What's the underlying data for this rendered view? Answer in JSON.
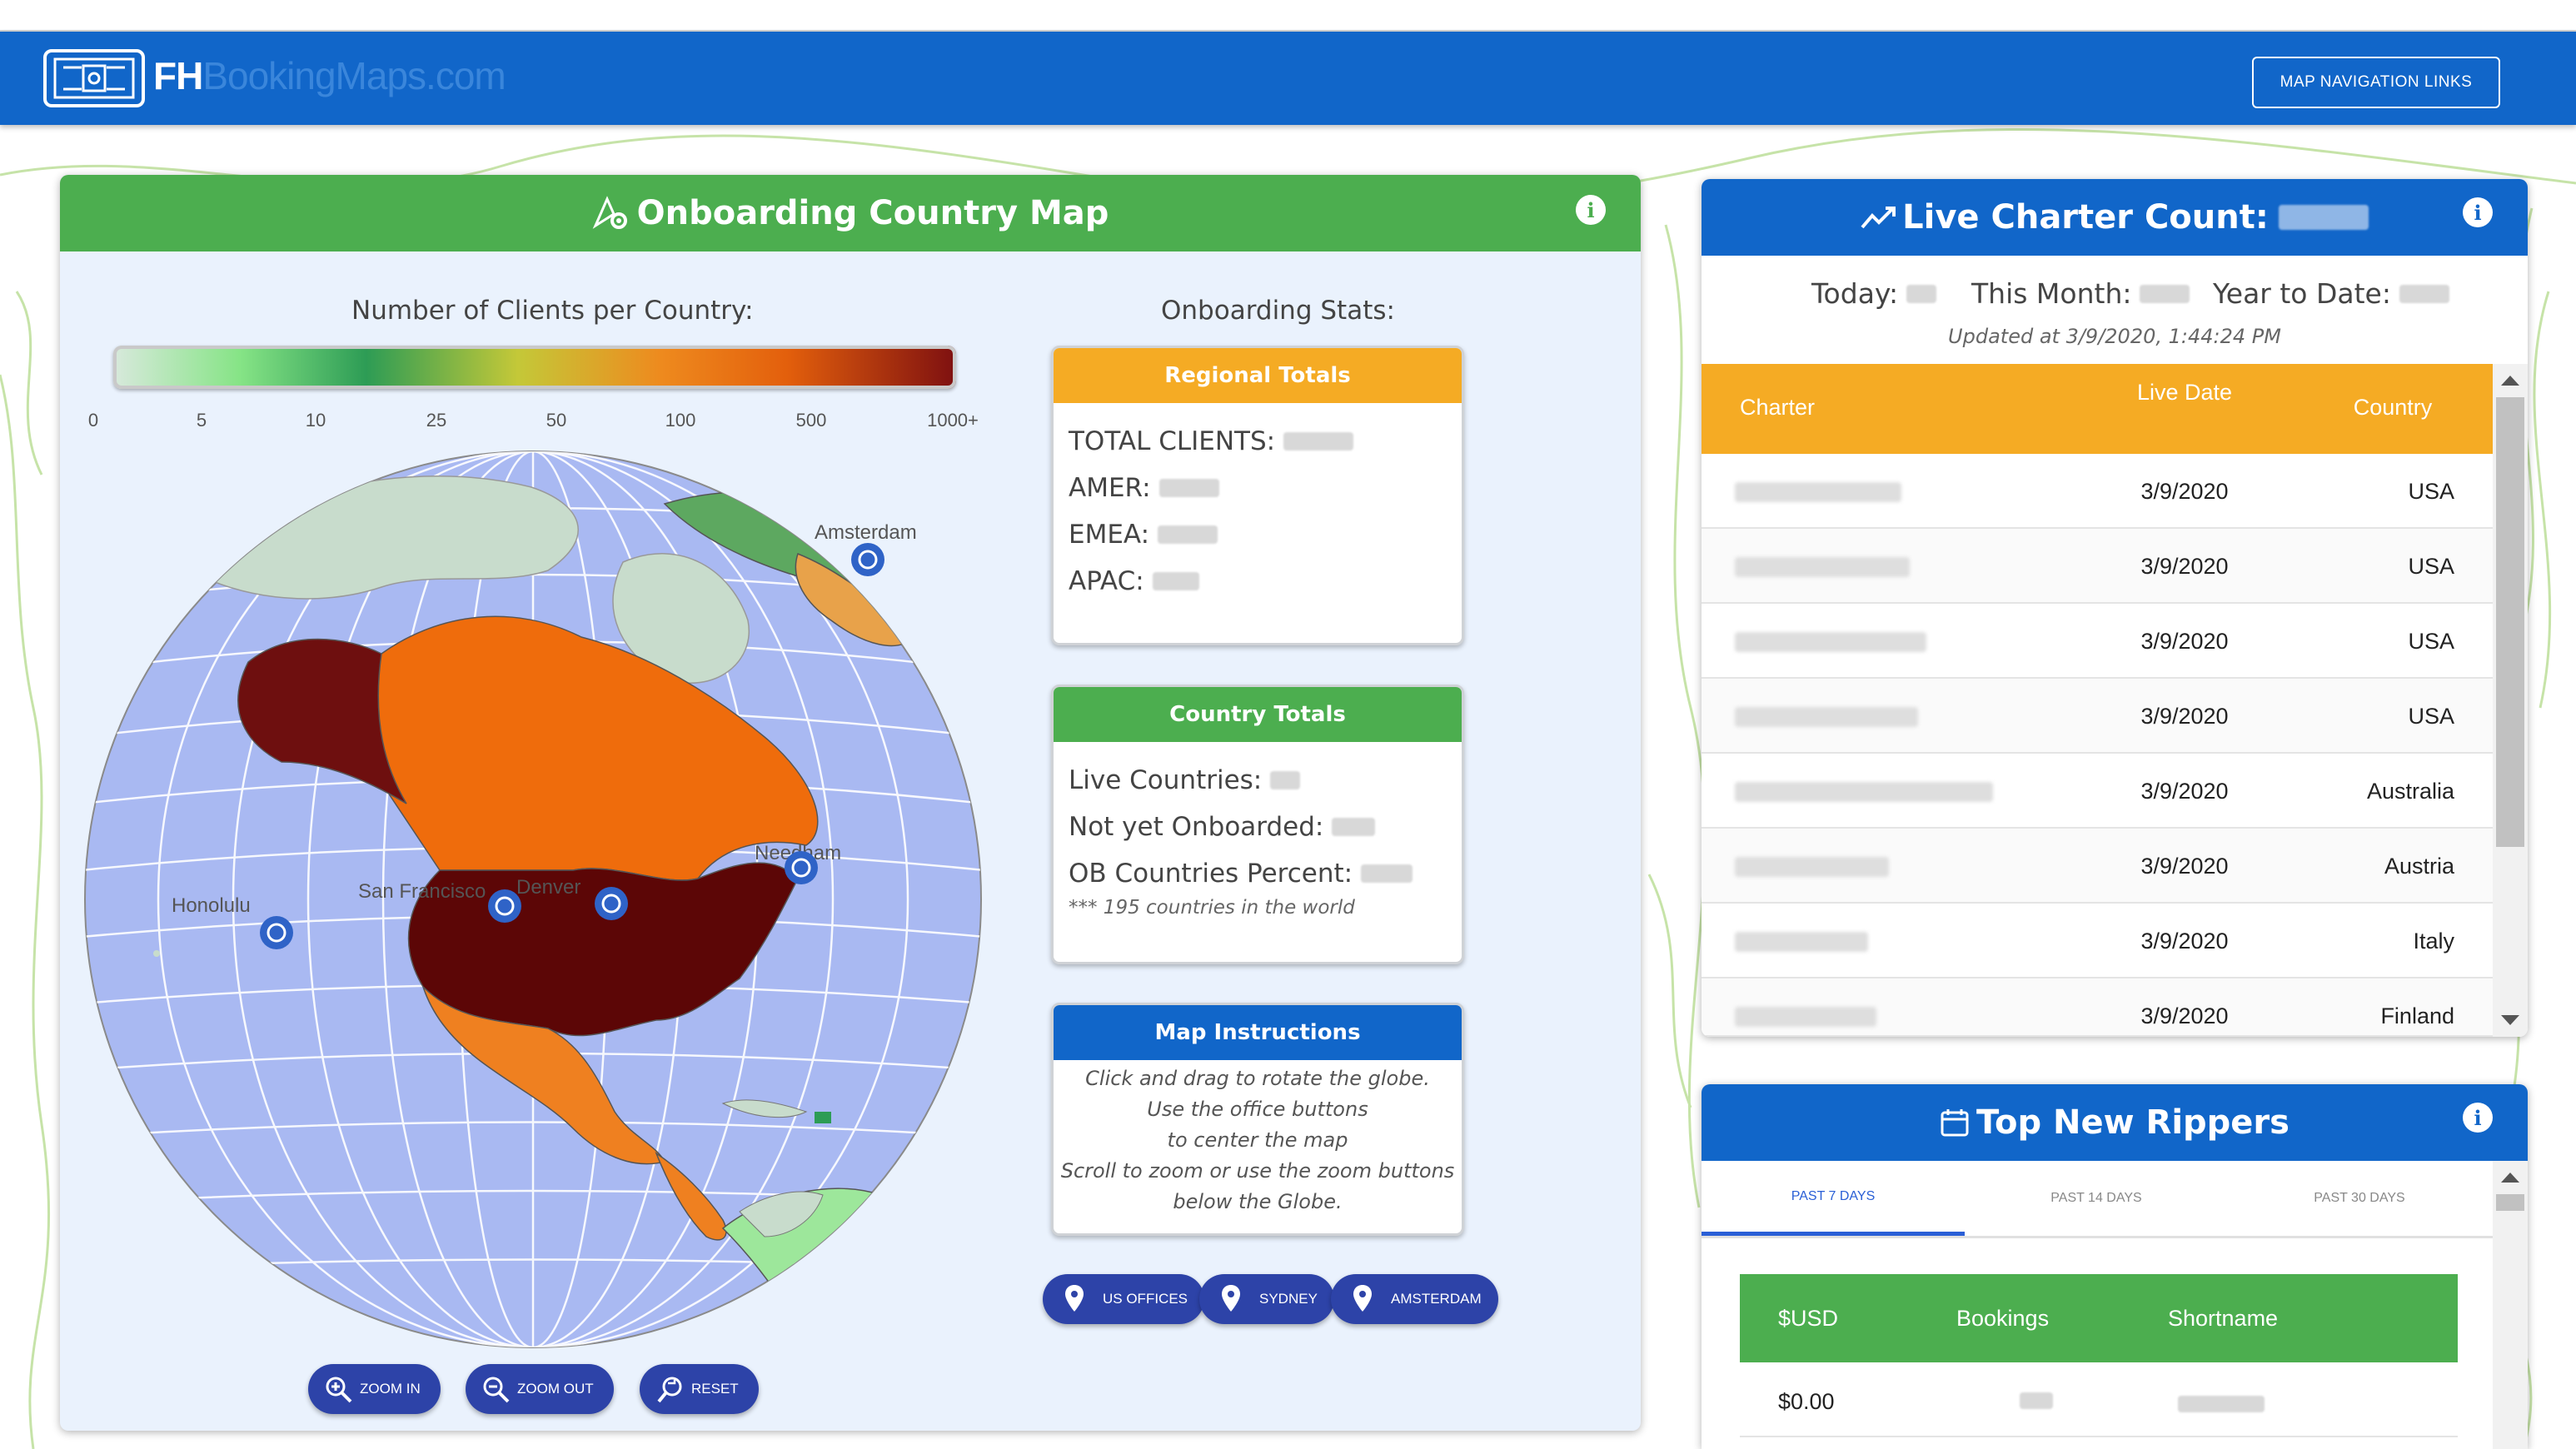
{
  "header": {
    "logo_bold": "FH",
    "logo_rest": "BookingMaps.com",
    "nav_button": "MAP NAVIGATION LINKS"
  },
  "map_panel": {
    "title": "Onboarding Country Map",
    "legend_title": "Number of Clients per Country:",
    "legend_ticks": [
      "0",
      "5",
      "10",
      "25",
      "50",
      "100",
      "500",
      "1000+"
    ],
    "city_labels": [
      "Amsterdam",
      "Needham",
      "San Francisco",
      "Denver",
      "Honolulu"
    ],
    "zoom_in": "ZOOM IN",
    "zoom_out": "ZOOM OUT",
    "reset": "RESET",
    "stats_title": "Onboarding Stats:",
    "regional": {
      "title": "Regional Totals",
      "total_clients": "TOTAL CLIENTS:",
      "amer": "AMER:",
      "emea": "EMEA:",
      "apac": "APAC:"
    },
    "country_totals": {
      "title": "Country Totals",
      "live": "Live Countries:",
      "not_yet": "Not yet Onboarded:",
      "percent": "OB Countries Percent:",
      "note": "*** 195 countries in the world"
    },
    "instructions": {
      "title": "Map Instructions",
      "lines": [
        "Click and drag to rotate the globe.",
        "Use the office buttons",
        "to center the map",
        "Scroll to zoom or use the zoom buttons",
        "below the Globe."
      ]
    },
    "office_buttons": [
      "US OFFICES",
      "SYDNEY",
      "AMSTERDAM"
    ]
  },
  "charter_panel": {
    "title": "Live Charter Count:",
    "today_label": "Today:",
    "month_label": "This Month:",
    "ytd_label": "Year to Date:",
    "updated": "Updated at 3/9/2020, 1:44:24 PM",
    "columns": [
      "Charter",
      "Live Date",
      "Country"
    ],
    "rows": [
      {
        "date": "3/9/2020",
        "country": "USA"
      },
      {
        "date": "3/9/2020",
        "country": "USA"
      },
      {
        "date": "3/9/2020",
        "country": "USA"
      },
      {
        "date": "3/9/2020",
        "country": "USA"
      },
      {
        "date": "3/9/2020",
        "country": "Australia"
      },
      {
        "date": "3/9/2020",
        "country": "Austria"
      },
      {
        "date": "3/9/2020",
        "country": "Italy"
      },
      {
        "date": "3/9/2020",
        "country": "Finland"
      }
    ]
  },
  "rippers_panel": {
    "title": "Top New Rippers",
    "tabs": [
      "PAST 7 DAYS",
      "PAST 14 DAYS",
      "PAST 30 DAYS"
    ],
    "columns": [
      "$USD",
      "Bookings",
      "Shortname"
    ],
    "rows": [
      {
        "usd": "$0.00"
      }
    ]
  },
  "colors": {
    "brand_blue": "#1166c9",
    "green": "#4cae4f",
    "orange": "#f5ab24",
    "button_blue": "#2d43a8"
  },
  "icons": [
    "info-icon",
    "map-settings-icon",
    "trending-up-icon",
    "calendar-icon",
    "zoom-in-icon",
    "zoom-out-icon",
    "reset-icon",
    "map-pin-icon",
    "office-marker-icon"
  ]
}
